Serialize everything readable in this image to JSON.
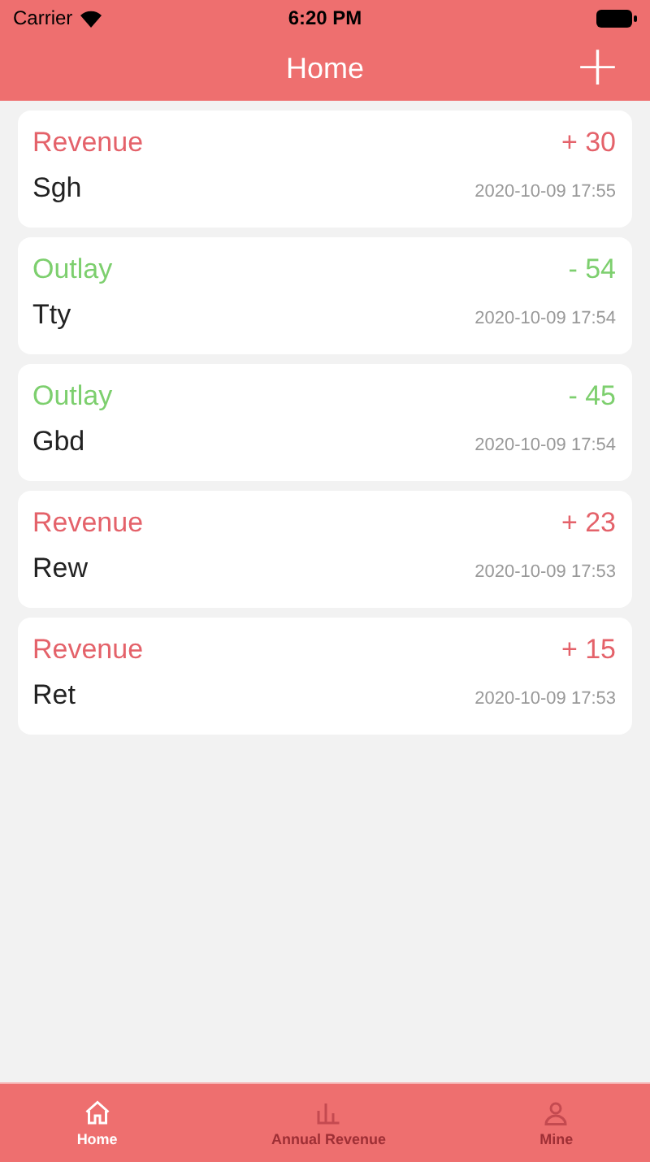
{
  "status_bar": {
    "carrier": "Carrier",
    "time": "6:20 PM"
  },
  "nav": {
    "title": "Home",
    "action": "+"
  },
  "records": [
    {
      "kind": "revenue",
      "category": "Revenue",
      "amount": "+ 30",
      "note": "Sgh",
      "time": "2020-10-09 17:55"
    },
    {
      "kind": "outlay",
      "category": "Outlay",
      "amount": "- 54",
      "note": "Tty",
      "time": "2020-10-09 17:54"
    },
    {
      "kind": "outlay",
      "category": "Outlay",
      "amount": "- 45",
      "note": "Gbd",
      "time": "2020-10-09 17:54"
    },
    {
      "kind": "revenue",
      "category": "Revenue",
      "amount": "+ 23",
      "note": "Rew",
      "time": "2020-10-09 17:53"
    },
    {
      "kind": "revenue",
      "category": "Revenue",
      "amount": "+ 15",
      "note": "Ret",
      "time": "2020-10-09 17:53"
    }
  ],
  "tabs": [
    {
      "kind": "home",
      "label": "Home",
      "selected": true
    },
    {
      "kind": "chart",
      "label": "Annual Revenue",
      "selected": false
    },
    {
      "kind": "person",
      "label": "Mine",
      "selected": false
    }
  ]
}
